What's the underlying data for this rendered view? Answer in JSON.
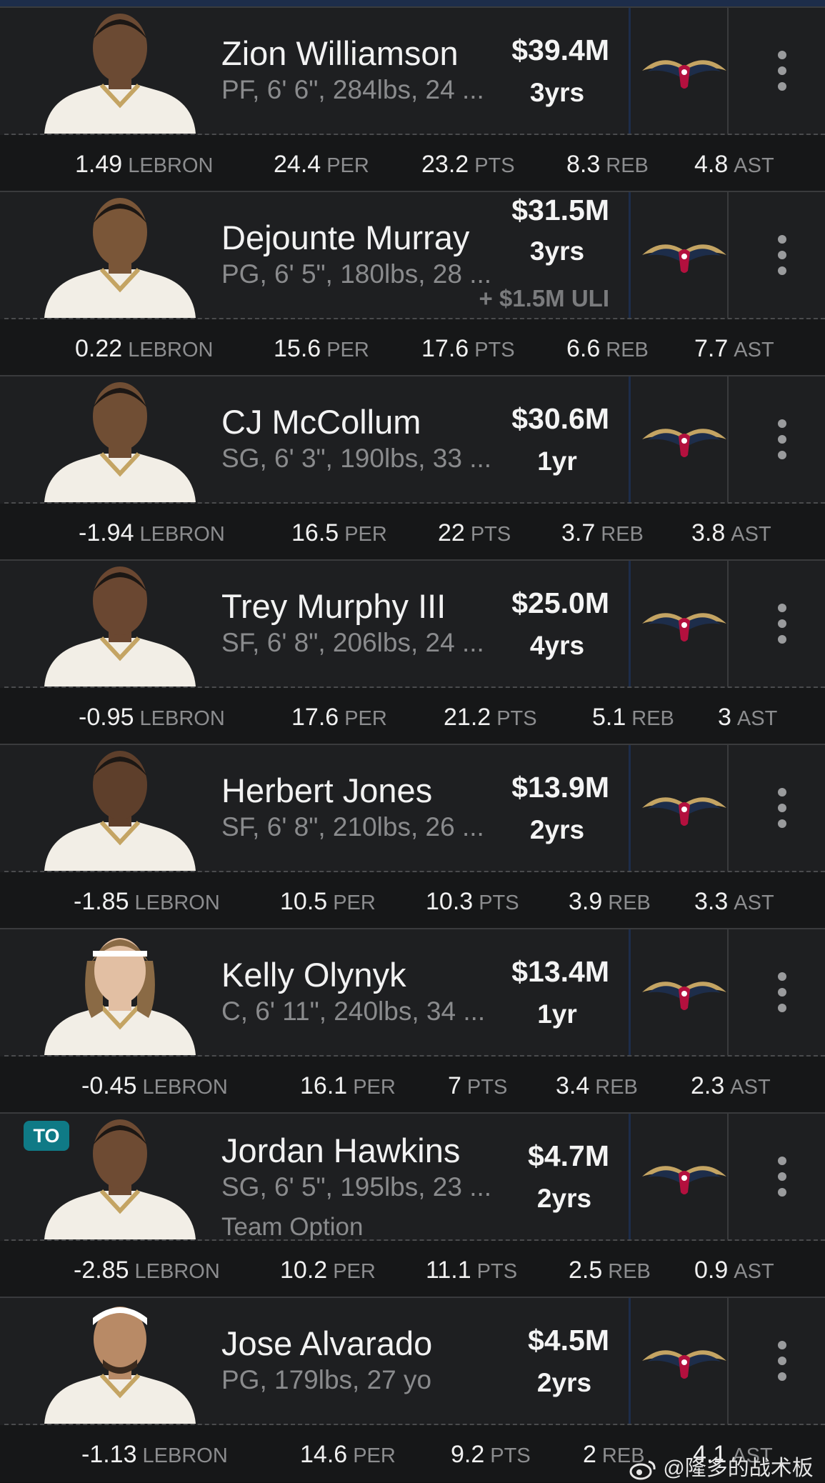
{
  "colors": {
    "accent_navy": "#1d2d4a",
    "gold": "#c4a463",
    "red": "#b3103e",
    "badge_teal": "#0f7a86"
  },
  "stat_keys": {
    "lebron": "LEBRON",
    "per": "PER",
    "pts": "PTS",
    "reb": "REB",
    "ast": "AST"
  },
  "players": [
    {
      "name": "Zion Williamson",
      "details": "PF, 6' 6\", 284lbs, 24 ...",
      "salary": "$39.4M",
      "years": "3yrs",
      "stats": {
        "lebron": "1.49",
        "per": "24.4",
        "pts": "23.2",
        "reb": "8.3",
        "ast": "4.8"
      }
    },
    {
      "name": "Dejounte Murray",
      "details": "PG, 6' 5\", 180lbs, 28 ...",
      "salary": "$31.5M",
      "years": "3yrs",
      "extra": "+ $1.5M ULI",
      "stats": {
        "lebron": "0.22",
        "per": "15.6",
        "pts": "17.6",
        "reb": "6.6",
        "ast": "7.7"
      }
    },
    {
      "name": "CJ McCollum",
      "details": "SG, 6' 3\", 190lbs, 33 ...",
      "salary": "$30.6M",
      "years": "1yr",
      "stats": {
        "lebron": "-1.94",
        "per": "16.5",
        "pts": "22",
        "reb": "3.7",
        "ast": "3.8"
      }
    },
    {
      "name": "Trey Murphy III",
      "details": "SF, 6' 8\", 206lbs, 24 ...",
      "salary": "$25.0M",
      "years": "4yrs",
      "stats": {
        "lebron": "-0.95",
        "per": "17.6",
        "pts": "21.2",
        "reb": "5.1",
        "ast": "3"
      }
    },
    {
      "name": "Herbert Jones",
      "details": "SF, 6' 8\", 210lbs, 26 ...",
      "salary": "$13.9M",
      "years": "2yrs",
      "stats": {
        "lebron": "-1.85",
        "per": "10.5",
        "pts": "10.3",
        "reb": "3.9",
        "ast": "3.3"
      }
    },
    {
      "name": "Kelly Olynyk",
      "details": "C, 6' 11\", 240lbs, 34 ...",
      "salary": "$13.4M",
      "years": "1yr",
      "stats": {
        "lebron": "-0.45",
        "per": "16.1",
        "pts": "7",
        "reb": "3.4",
        "ast": "2.3"
      }
    },
    {
      "name": "Jordan Hawkins",
      "details": "SG, 6' 5\", 195lbs, 23 ...",
      "option": "Team Option",
      "badge": "TO",
      "salary": "$4.7M",
      "years": "2yrs",
      "stats": {
        "lebron": "-2.85",
        "per": "10.2",
        "pts": "11.1",
        "reb": "2.5",
        "ast": "0.9"
      }
    },
    {
      "name": "Jose Alvarado",
      "details": "PG, 179lbs, 27 yo",
      "salary": "$4.5M",
      "years": "2yrs",
      "stats": {
        "lebron": "-1.13",
        "per": "14.6",
        "pts": "9.2",
        "reb": "2",
        "ast": "4.1"
      }
    }
  ],
  "watermark": "@隆多的战术板"
}
